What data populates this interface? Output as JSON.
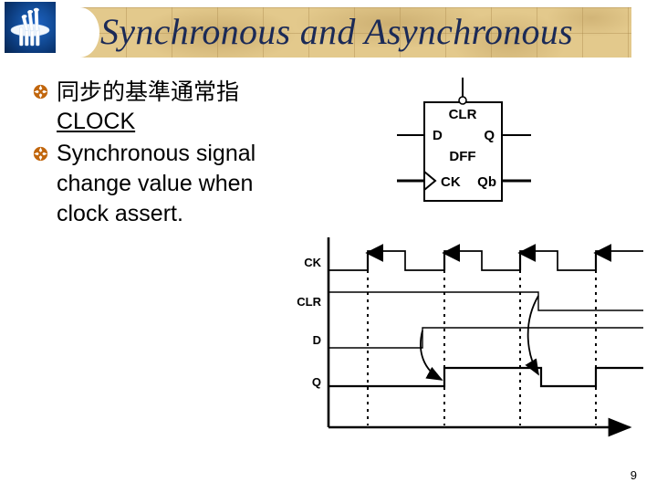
{
  "slide": {
    "title": "Synchronous and Asynchronous",
    "page_number": "9",
    "logo_icon": "university-pillar-logo-icon"
  },
  "colors": {
    "banner_background": "#e3c98c",
    "banner_grid": "#a07d41",
    "title_text": "#1b2a57",
    "logo_background": "#14509f",
    "bullet_marker": "#c1660d",
    "body_text": "#000000",
    "figure_line": "#000000"
  },
  "bullets": [
    {
      "marker_icon": "flower-bullet-icon",
      "lines": [
        {
          "text": "同步的基準通常指",
          "underline": false,
          "cjk": true
        },
        {
          "text": "CLOCK",
          "underline": true,
          "cjk": false
        }
      ]
    },
    {
      "marker_icon": "flower-bullet-icon",
      "lines": [
        {
          "text": "Synchronous signal",
          "underline": false,
          "cjk": false
        },
        {
          "text": "change value when",
          "underline": false,
          "cjk": false
        },
        {
          "text": "clock assert.",
          "underline": false,
          "cjk": false
        }
      ]
    }
  ],
  "dff_diagram": {
    "name": "d-flip-flop-block-diagram",
    "body_label": "DFF",
    "pins": {
      "clear_top": "CLR",
      "data_in": "D",
      "clock_in": "CK",
      "q_out": "Q",
      "qbar_out": "Qb"
    },
    "clear_is_active_low_bubble": true,
    "clock_has_edge_triangle": true
  },
  "chart_data": {
    "type": "line",
    "title": "DFF timing diagram",
    "xlabel": "",
    "ylabel": "",
    "signals": [
      "CK",
      "CLR",
      "D",
      "Q"
    ],
    "legend_position": "left-axis-labels",
    "grid": false,
    "time_markers": [
      1,
      2,
      3,
      4
    ],
    "series": [
      {
        "name": "CK",
        "description": "Four rising-edge clock pulses; rising edges marked with up arrows",
        "transitions": [
          {
            "t": 0.0,
            "level": 0
          },
          {
            "t": 1.0,
            "level": 1
          },
          {
            "t": 1.45,
            "level": 0
          },
          {
            "t": 2.0,
            "level": 1
          },
          {
            "t": 2.45,
            "level": 0
          },
          {
            "t": 3.0,
            "level": 1
          },
          {
            "t": 3.45,
            "level": 0
          },
          {
            "t": 4.0,
            "level": 1
          }
        ]
      },
      {
        "name": "CLR",
        "description": "High until shortly after the third clock edge, then falls low",
        "transitions": [
          {
            "t": 0.0,
            "level": 1
          },
          {
            "t": 3.25,
            "level": 0
          }
        ]
      },
      {
        "name": "D",
        "description": "Low, rises high before the second clock edge and stays high",
        "transitions": [
          {
            "t": 0.0,
            "level": 0
          },
          {
            "t": 1.65,
            "level": 1
          }
        ]
      },
      {
        "name": "Q",
        "description": "Low; goes high on the second clock rising edge, cleared low when CLR falls, goes high again on the fourth clock rising edge",
        "transitions": [
          {
            "t": 0.0,
            "level": 0
          },
          {
            "t": 2.0,
            "level": 1
          },
          {
            "t": 3.3,
            "level": 0
          },
          {
            "t": 4.0,
            "level": 1
          }
        ]
      }
    ],
    "annotations": [
      {
        "type": "curved-arrow",
        "from": "D rising edge",
        "to": "Q rising edge at 2nd clock",
        "label": ""
      },
      {
        "type": "curved-arrow",
        "from": "CLR falling edge",
        "to": "Q falling edge",
        "label": ""
      },
      {
        "type": "rising-edge-arrow",
        "on": "CK",
        "count": 4
      },
      {
        "type": "dashed-time-marker",
        "count": 4
      },
      {
        "type": "time-axis-arrow",
        "direction": "right"
      }
    ]
  }
}
